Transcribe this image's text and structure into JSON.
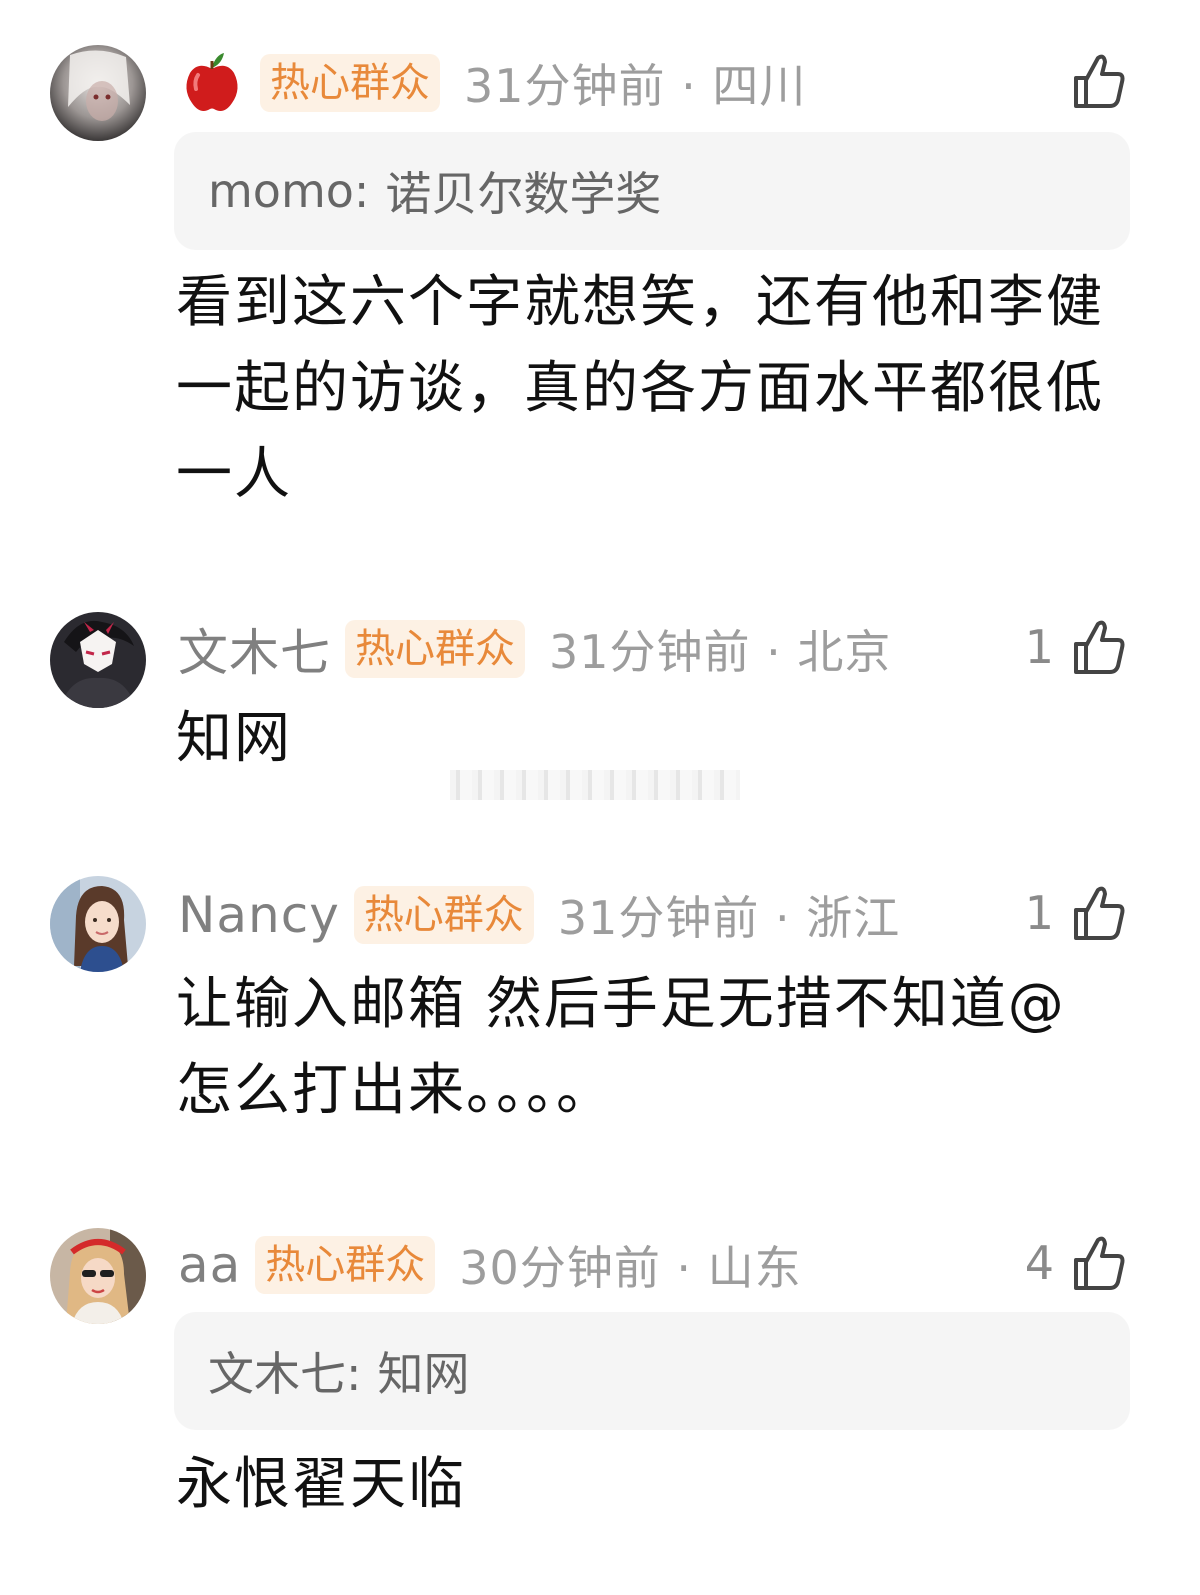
{
  "comments": [
    {
      "name": "",
      "has_apple_icon": true,
      "badge": "热心群众",
      "meta": "31分钟前 · 四川",
      "like_count": "",
      "quote_author": "momo:",
      "quote_text": "诺贝尔数学奖",
      "body": "看到这六个字就想笑，还有他和李健一起的访谈，真的各方面水平都很低一人"
    },
    {
      "name": "文木七",
      "badge": "热心群众",
      "meta": "31分钟前 · 北京",
      "like_count": "1",
      "body": "知网"
    },
    {
      "name": "Nancy",
      "badge": "热心群众",
      "meta": "31分钟前 · 浙江",
      "like_count": "1",
      "body": "让输入邮箱 然后手足无措不知道@怎么打出来。。。。"
    },
    {
      "name": "aa",
      "badge": "热心群众",
      "meta": "30分钟前 · 山东",
      "like_count": "4",
      "quote_author": "文木七:",
      "quote_text": "知网",
      "body": "永恨翟天临"
    }
  ],
  "colors": {
    "badge_bg": "#fdf1e4",
    "badge_text": "#e8893a",
    "meta_text": "#9d9d9d",
    "quote_bg": "#f5f5f5"
  },
  "icons": {
    "like": "thumbs-up-icon",
    "apple": "apple-icon"
  }
}
